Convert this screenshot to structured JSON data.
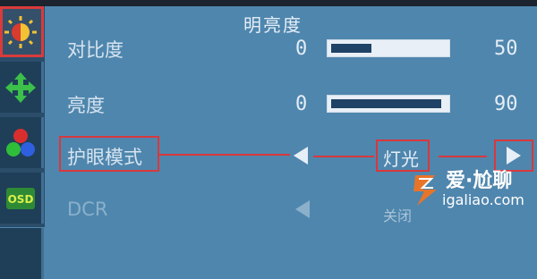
{
  "menu": {
    "title": "明亮度"
  },
  "rows": {
    "contrast": {
      "label": "对比度",
      "min": "0",
      "value": "50",
      "fill_fraction": 0.35
    },
    "brightness": {
      "label": "亮度",
      "min": "0",
      "value": "90",
      "fill_fraction": 0.96
    },
    "eye_mode": {
      "label": "护眼模式",
      "value": "灯光"
    },
    "dcr": {
      "label": "DCR",
      "value": "关闭"
    }
  },
  "sidebar": {
    "items": [
      {
        "icon": "brightness-sun-icon",
        "selected": true
      },
      {
        "icon": "position-arrows-icon",
        "selected": false
      },
      {
        "icon": "color-rgb-icon",
        "selected": false
      },
      {
        "icon": "osd-icon",
        "label": "OSD",
        "selected": false
      },
      {
        "icon": "unknown-icon",
        "selected": false
      }
    ]
  },
  "watermark": {
    "brand": "爱·尬聊",
    "url": "igaliao.com"
  },
  "colors": {
    "background": "#4f86ad",
    "annotation_red": "#d8383d",
    "bar_fill": "#1f4366"
  }
}
